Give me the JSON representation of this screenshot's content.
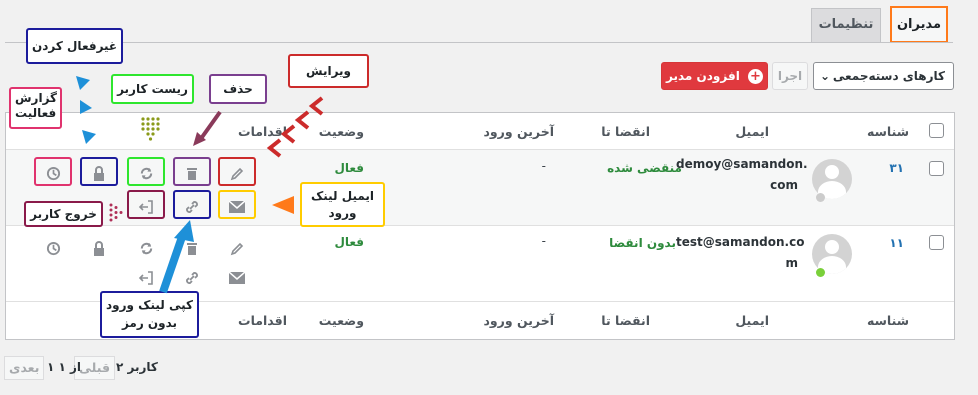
{
  "tabs": [
    {
      "label": "مدیران",
      "active": true
    },
    {
      "label": "تنظیمات",
      "active": false
    }
  ],
  "toolbar": {
    "add_button": "افزودن مدیر",
    "apply_button": "اجرا",
    "bulk_select": "کارهای دستەجمعی"
  },
  "table": {
    "columns": [
      "شناسه",
      "ایمیل",
      "انقضا تا",
      "آخرین ورود",
      "وضعیت",
      "اقدامات"
    ],
    "rows": [
      {
        "id": "۳۱",
        "email_line1": "demoy@samandon.",
        "email_line2": "com",
        "expiry": "منقضی شده",
        "last_login": "-",
        "status": "فعال",
        "avatar_status_color": "#cccccc"
      },
      {
        "id": "۱۱",
        "email_line1": "test@samandon.co",
        "email_line2": "m",
        "expiry": "بدون انقضا",
        "last_login": "-",
        "status": "فعال",
        "avatar_status_color": "#7ad03a"
      }
    ]
  },
  "annotations": {
    "deactivate": "غیرفعال کردن",
    "edit": "ویرایش",
    "reset_user": "ریست کاربر",
    "delete": "حذف",
    "activity_report_1": "گزارش",
    "activity_report_2": "فعالیت",
    "email_login_link_1": "ایمیل لینک",
    "email_login_link_2": "ورود",
    "user_logout": "خروج کاربر",
    "copy_link_1": "کپی لینک ورود",
    "copy_link_2": "بدون رمز"
  },
  "footer": {
    "count_text": "۲ کاربر",
    "prev": "قبلی",
    "page_info": "۱ از ۱",
    "next": "بعدی"
  },
  "colors": {
    "annotation_blue": "#1c1c9c",
    "annotation_red": "#cc2b2b",
    "annotation_green": "#2ee62e",
    "annotation_purple": "#7a3f8f",
    "annotation_pink": "#e0336e",
    "annotation_yellow": "#ffcc00",
    "annotation_orange": "#ff7a1a",
    "arrow_blue": "#1e90d8",
    "olive_dots": "#8a9a1a",
    "maroon_dots": "#b03058"
  }
}
